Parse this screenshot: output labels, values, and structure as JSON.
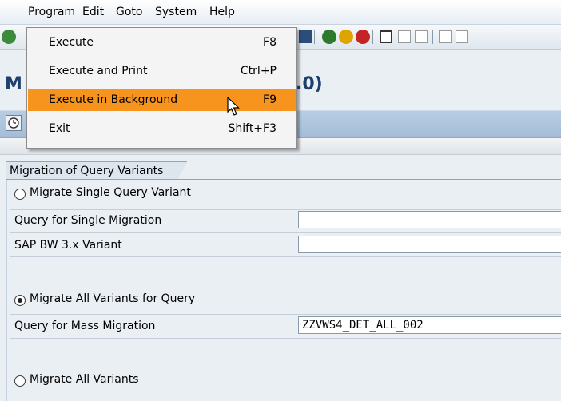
{
  "menubar": {
    "items": [
      {
        "label": "Program"
      },
      {
        "label": "Edit"
      },
      {
        "label": "Goto"
      },
      {
        "label": "System"
      },
      {
        "label": "Help"
      }
    ]
  },
  "title": {
    "start": "M",
    "end": ".0)"
  },
  "group": {
    "title": "Migration of Query Variants",
    "radio_single": "Migrate Single Query Variant",
    "query_single_label": "Query for Single Migration",
    "query_single_value": "",
    "bw_variant_label": "SAP BW 3.x Variant",
    "bw_variant_value": "",
    "radio_all_for_query": "Migrate All Variants for Query",
    "query_mass_label": "Query for Mass Migration",
    "query_mass_value": "ZZVWS4_DET_ALL_002",
    "radio_all": "Migrate All Variants",
    "selected": "radio_all_for_query"
  },
  "dropdown": {
    "items": [
      {
        "label": "Execute",
        "shortcut": "F8"
      },
      {
        "label": "Execute and Print",
        "shortcut": "Ctrl+P"
      },
      {
        "label": "Execute in Background",
        "shortcut": "F9"
      },
      {
        "label": "Exit",
        "shortcut": "Shift+F3"
      }
    ],
    "highlighted": "Execute in Background"
  },
  "colors": {
    "highlight": "#f7941d",
    "app_toolbar": "#a9c1da",
    "title": "#1d3f6b",
    "background": "#eaeff4"
  }
}
